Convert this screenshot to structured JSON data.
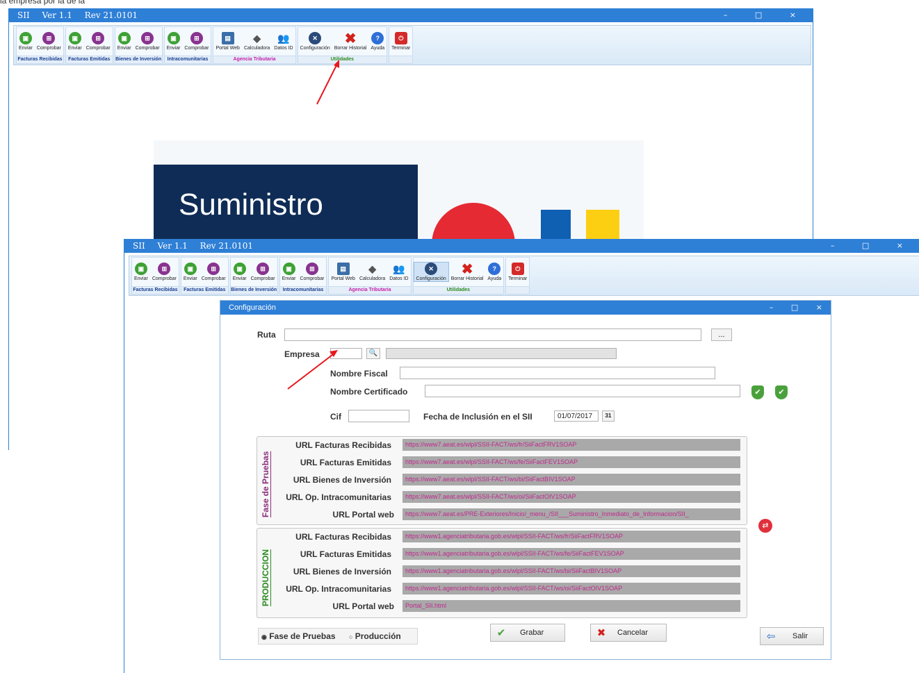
{
  "page": {
    "top_crop_text": "la empresa por la de la"
  },
  "back_window": {
    "title_app": "SII",
    "title_ver": "Ver 1.1",
    "title_rev": "Rev 21.0101",
    "banner_title": "Suministro"
  },
  "front_window": {
    "title_app": "SII",
    "title_ver": "Ver 1.1",
    "title_rev": "Rev 21.0101"
  },
  "window_controls": {
    "minimize": "–",
    "maximize": "□",
    "close": "×"
  },
  "ribbon": {
    "groups": [
      {
        "caption": "Facturas Recibidas",
        "b1": "Enviar",
        "b2": "Comprobar"
      },
      {
        "caption": "Facturas Emitidas",
        "b1": "Enviar",
        "b2": "Comprobar"
      },
      {
        "caption": "Bienes de Inversión",
        "b1": "Enviar",
        "b2": "Comprobar"
      },
      {
        "caption": "Intracomunitarias",
        "b1": "Enviar",
        "b2": "Comprobar"
      }
    ],
    "agencia": {
      "caption": "Agencia Tributaria",
      "portal": "Portal Web",
      "calc": "Calculadora",
      "datos": "Datos ID"
    },
    "utilidades": {
      "caption": "Utilidades",
      "config": "Configuración",
      "borrar": "Borrar Historial",
      "ayuda": "Ayuda"
    },
    "terminar": "Terminar"
  },
  "dialog": {
    "title": "Configuración",
    "ruta_label": "Ruta",
    "ruta_value": "",
    "browse_label": "...",
    "empresa_label": "Empresa",
    "empresa_code": "",
    "empresa_name": "",
    "nombre_fiscal_label": "Nombre Fiscal",
    "nombre_fiscal_value": "",
    "nombre_cert_label": "Nombre Certificado",
    "nombre_cert_value": "",
    "cif_label": "Cif",
    "cif_value": "",
    "fecha_label": "Fecha de Inclusión en el SII",
    "fecha_value": "01/07/2017",
    "calendar_label": "31",
    "pruebas": {
      "frame_label": "Fase de Pruebas",
      "rows": [
        {
          "label": "URL Facturas Recibidas",
          "value": "https://www7.aeat.es/wlpl/SSII-FACT/ws/fr/SiiFactFRV1SOAP"
        },
        {
          "label": "URL Facturas Emitidas",
          "value": "https://www7.aeat.es/wlpl/SSII-FACT/ws/fe/SiiFactFEV1SOAP"
        },
        {
          "label": "URL Bienes de Inversión",
          "value": "https://www7.aeat.es/wlpl/SSII-FACT/ws/bi/SiiFactBIV1SOAP"
        },
        {
          "label": "URL Op. Intracomunitarias",
          "value": "https://www7.aeat.es/wlpl/SSII-FACT/ws/oi/SiiFactOIV1SOAP"
        },
        {
          "label": "URL Portal web",
          "value": "https://www7.aeat.es/PRE-Exteriores/Inicio/_menu_/SII___Suministro_Inmediato_de_Informacion/SII_"
        }
      ]
    },
    "produccion": {
      "frame_label": "PRODUCCION",
      "rows": [
        {
          "label": "URL Facturas Recibidas",
          "value": "https://www1.agenciatributaria.gob.es/wlpl/SSII-FACT/ws/fr/SiiFactFRV1SOAP"
        },
        {
          "label": "URL Facturas Emitidas",
          "value": "https://www1.agenciatributaria.gob.es/wlpl/SSII-FACT/ws/fe/SiiFactFEV1SOAP"
        },
        {
          "label": "URL Bienes de Inversión",
          "value": "https://www1.agenciatributaria.gob.es/wlpl/SSII-FACT/ws/bi/SiiFactBIV1SOAP"
        },
        {
          "label": "URL Op. Intracomunitarias",
          "value": "https://www1.agenciatributaria.gob.es/wlpl/SSII-FACT/ws/oi/SiiFactOIV1SOAP"
        },
        {
          "label": "URL Portal web",
          "value": "Portal_SII.html"
        }
      ]
    },
    "mode_pruebas": "Fase de Pruebas",
    "mode_produccion": "Producción",
    "grabar": "Grabar",
    "cancelar": "Cancelar",
    "salir": "Salir"
  },
  "colors": {
    "titlebar": "#2e7fd6",
    "arrow": "#e8161b",
    "url_text": "#c02a8e",
    "pruebas_label": "#8b2c7a",
    "produccion_label": "#2a8a1e"
  }
}
